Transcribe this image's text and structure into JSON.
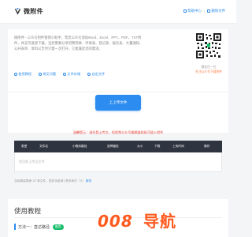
{
  "header": {
    "logo_text": "微附件",
    "nav": [
      {
        "label": "帮助中心",
        "icon": "help-icon"
      },
      {
        "label": "删除文件",
        "icon": "trash-icon"
      }
    ]
  },
  "intro": {
    "text": "微附件 - 公众号附件管理小助手，帮您公众号添加Word、Excel、PPT、PDF、TXT附件，并支持直接下载。当您需要分享招聘简章、申请表、登记表、报名表、大量通知、公开表单、资料公告时只需一次打开，它能满足您的需求。",
    "links": [
      {
        "label": "使用教程",
        "icon": "book-icon"
      },
      {
        "label": "常见问题",
        "icon": "question-icon"
      },
      {
        "label": "文件存储",
        "icon": "storage-icon"
      },
      {
        "label": "自定文件",
        "icon": "file-icon"
      }
    ],
    "qr_caption_1": "微信扫一扫",
    "qr_caption_2": "关注公众号下载附件"
  },
  "upload": {
    "button_label": "上上传文件"
  },
  "notice": "温馨提示：请先登上传文，短视频公众号编辑器粘贴可插入附件",
  "table": {
    "columns": [
      "类型",
      "文件名",
      "小程序路径",
      "选择路径",
      "大小",
      "下载",
      "上传时间",
      "操作"
    ]
  },
  "file_row": {
    "placeholder": "您目前上传过文件"
  },
  "footnote": {
    "text": "当前最高限速 1G 单文件，更多功能请 | 联系我们（V）",
    "link": "服务"
  },
  "guide": {
    "title": "使用教程",
    "method_label": "方法一：直达路径",
    "badge": "推荐"
  },
  "watermark": {
    "digits": "008",
    "text": "导航"
  },
  "colors": {
    "accent": "#2d8cf0",
    "table_header": "#2f3441",
    "notice": "#e8453c",
    "badge": "#19be6b",
    "watermark": "#ff5a1f"
  }
}
